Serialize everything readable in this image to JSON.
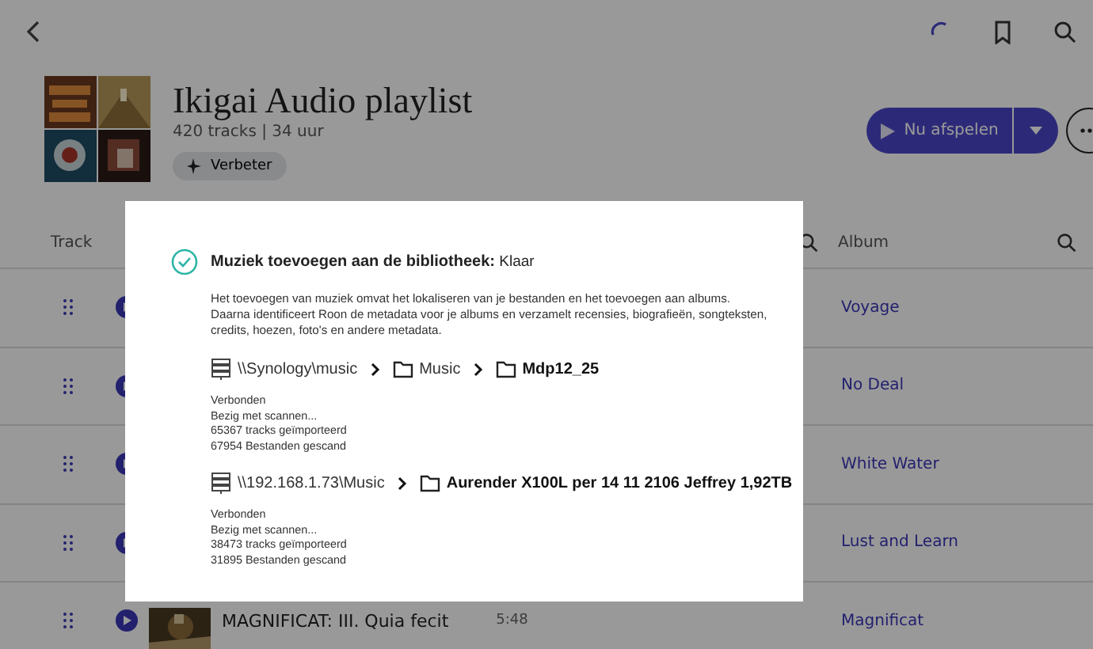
{
  "playlist": {
    "title": "Ikigai Audio playlist",
    "meta": "420 tracks | 34 uur",
    "enhance_button": "Verbeter",
    "play_button": "Nu afspelen"
  },
  "table": {
    "columns": [
      {
        "label": "Track"
      },
      {
        "label": "Album"
      }
    ],
    "rows": [
      {
        "album": "Voyage"
      },
      {
        "album": "No Deal"
      },
      {
        "album": "White Water"
      },
      {
        "album": "Lust and Learn"
      },
      {
        "title": "MAGNIFICAT: III. Quia fecit",
        "duration": "5:48",
        "album": "Magnificat"
      }
    ]
  },
  "dialog": {
    "heading": "**Muziek toevoegen aan de bibliotheek:** Klaar",
    "done": true,
    "description": "Het toevoegen van muziek omvat het lokaliseren van je bestanden en het toevoegen aan albums. Daarna identificeert Roon de metadata voor je albums en verzamelt recensies, biografieën, songteksten, credits, hoezen, foto's en andere metadata.",
    "sources": [
      {
        "path": [
          {
            "kind": "server",
            "label": "\\\\Synology\\music"
          },
          {
            "kind": "folder",
            "label": "Music"
          },
          {
            "kind": "folder",
            "label": "Mdp12_25"
          }
        ],
        "status": [
          "Verbonden",
          "Bezig met scannen...",
          "65367 tracks geïmporteerd",
          "67954 Bestanden gescand"
        ]
      },
      {
        "path": [
          {
            "kind": "server",
            "label": "\\\\192.168.1.73\\Music"
          },
          {
            "kind": "folder",
            "label": "Aurender X100L per 14 11 2106 Jeffrey 1,92TB"
          }
        ],
        "status": [
          "Verbonden",
          "Bezig met scannen...",
          "38473 tracks geïmporteerd",
          "31895 Bestanden gescand"
        ]
      }
    ]
  }
}
